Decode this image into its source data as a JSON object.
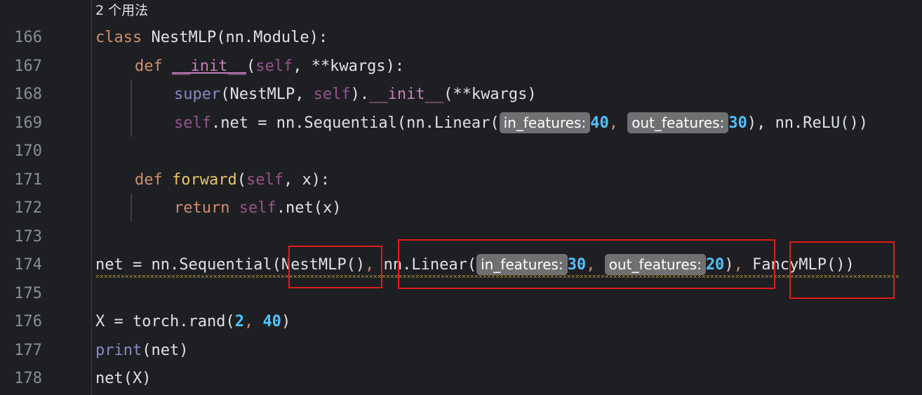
{
  "usage_hint": "2 个用法",
  "line_numbers": [
    "166",
    "167",
    "168",
    "169",
    "170",
    "171",
    "172",
    "173",
    "174",
    "175",
    "176",
    "177",
    "178"
  ],
  "code": {
    "l166": {
      "kw": "class",
      "rest": " NestMLP(nn.Module):"
    },
    "l167": {
      "kw": "def",
      "sp": " ",
      "name": "__init__",
      "p1": "(",
      "self": "self",
      "rest": ", **kwargs):"
    },
    "l168": {
      "builtin": "super",
      "p1": "(NestMLP, ",
      "self": "self",
      "p2": ").",
      "name": "__init__",
      "rest": "(**kwargs)"
    },
    "l169": {
      "self": "self",
      "p1": ".net = nn.Sequential(nn.Linear(",
      "hint1": "in_features:",
      "n1": "40",
      "c1": ", ",
      "hint2": "out_features:",
      "n2": "30",
      "rest": "), nn.ReLU())"
    },
    "l171": {
      "kw": "def",
      "sp": " ",
      "name": "forward",
      "p1": "(",
      "self": "self",
      "rest": ", x):"
    },
    "l172": {
      "kw": "return",
      "sp": " ",
      "self": "self",
      "rest": ".net(x)"
    },
    "l174": {
      "p1": "net = nn.Sequential(",
      "a1": "NestMLP()",
      "c1": ",",
      "sp1": " ",
      "a2": "nn.Linear(",
      "hint1": "in_features:",
      "n1": "30",
      "c2": ", ",
      "hint2": "out_features:",
      "n2": "20",
      "p2": ")",
      "c3": ",",
      "sp2": " ",
      "a3": "FancyMLP()",
      "p3": ")"
    },
    "l176": {
      "p1": "X = torch.rand(",
      "n1": "2",
      "c1": ", ",
      "n2": "40",
      "p2": ")"
    },
    "l177": {
      "builtin": "print",
      "rest": "(net)"
    },
    "l178": {
      "rest": "net(X)"
    }
  }
}
